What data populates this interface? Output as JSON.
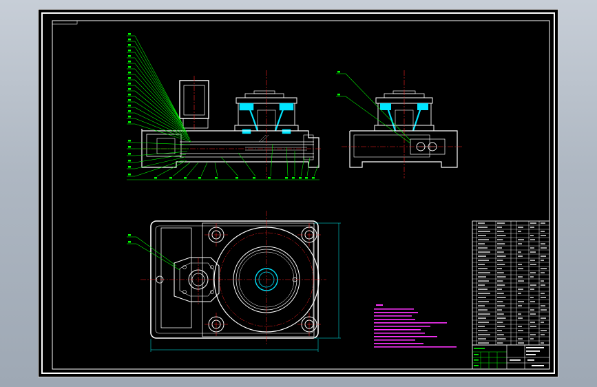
{
  "drawing": {
    "colors": {
      "background": "#000000",
      "outline": "#ffffff",
      "leader": "#00ff00",
      "centerline": "#ff2020",
      "hidden": "#00e5ff",
      "notes": "#ff33ff",
      "dimension": "#00ffff"
    },
    "views": [
      "front-section-view",
      "side-view",
      "top-view"
    ],
    "title_block": {
      "drawing_number": "",
      "scale": "",
      "name": ""
    }
  }
}
